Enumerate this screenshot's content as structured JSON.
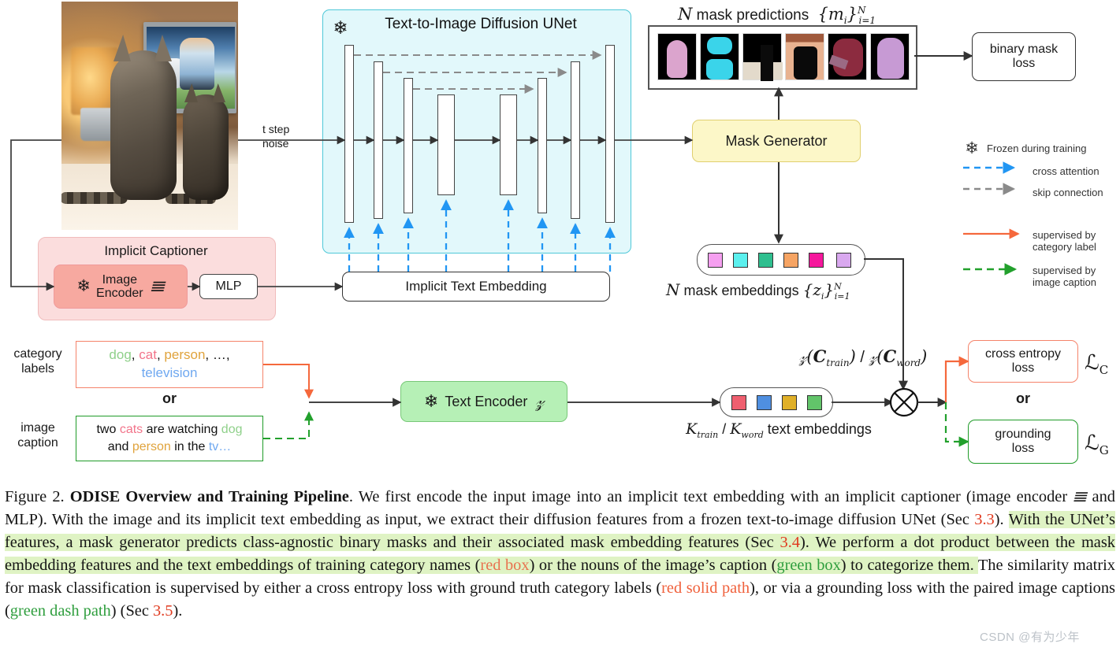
{
  "figure": {
    "title_prefix": "Figure 2.",
    "title_bold": "ODISE Overview and Training Pipeline",
    "watermark": "CSDN @有为少年"
  },
  "unet": {
    "title": "Text-to-Image Diffusion UNet",
    "frozen_icon": "snowflake-icon",
    "noise_label_line1": "t step",
    "noise_label_line2": "noise",
    "implicit_text_embedding": "Implicit Text Embedding",
    "block_heights": [
      226,
      200,
      172,
      128,
      128,
      172,
      200,
      226
    ],
    "block_x": [
      437,
      474,
      512,
      555,
      634,
      678,
      721,
      766
    ],
    "skip_count": 3
  },
  "captioner": {
    "title": "Implicit Captioner",
    "image_encoder_line1": "Image",
    "image_encoder_line2": "Encoder",
    "image_encoder_symbol": "ᵛ",
    "mlp": "MLP"
  },
  "mask_branch": {
    "mask_generator": "Mask Generator",
    "mask_predictions_label": "N mask predictions",
    "mask_predictions_math": "{m_i}_{i=1}^{N}",
    "binary_mask_loss_line1": "binary mask",
    "binary_mask_loss_line2": "loss",
    "mask_embeddings_label": "N mask embeddings",
    "mask_embeddings_math": "{z_i}_{i=1}^{N}",
    "mask_chip_colors": [
      "#f59ff0",
      "#5bf0ee",
      "#2fbf8f",
      "#f6a463",
      "#f5179c",
      "#d9a8ef"
    ],
    "thumb_colors": [
      "#d9a0c9",
      "#3ad2e8",
      "#e6ddd0",
      "#e8b08a",
      "#8e2b3f",
      "#c79ad4"
    ]
  },
  "text_branch": {
    "category_label_line1": "category",
    "category_label_line2": "labels",
    "caption_label_line1": "image",
    "caption_label_line2": "caption",
    "or_left": "or",
    "or_right": "or",
    "category_items": [
      {
        "text": "dog",
        "color": "#8fd08a"
      },
      {
        "text": ", ",
        "color": "#111111"
      },
      {
        "text": "cat",
        "color": "#f2748a"
      },
      {
        "text": ", ",
        "color": "#111111"
      },
      {
        "text": "person",
        "color": "#e0a33c"
      },
      {
        "text": ", …,",
        "color": "#111111"
      }
    ],
    "category_second_line": {
      "text": "television",
      "color": "#6fa8f0"
    },
    "caption_tokens": [
      {
        "text": "two ",
        "color": "#111111"
      },
      {
        "text": "cats ",
        "color": "#f2748a"
      },
      {
        "text": "are watching ",
        "color": "#111111"
      },
      {
        "text": "dog",
        "color": "#8fd08a"
      }
    ],
    "caption_tokens2": [
      {
        "text": "and ",
        "color": "#111111"
      },
      {
        "text": "person ",
        "color": "#e0a33c"
      },
      {
        "text": "in the ",
        "color": "#111111"
      },
      {
        "text": "tv…",
        "color": "#6fa8f0"
      }
    ],
    "text_encoder": "Text Encoder",
    "text_encoder_symbol": "𝒯",
    "text_embeddings_math": "𝒯(C_train) / 𝒯(C_word)",
    "text_embeddings_caption": "K_train / K_word text embeddings",
    "text_chip_colors": [
      "#ef5f6f",
      "#4f8fe0",
      "#e0b028",
      "#62c46a"
    ]
  },
  "losses": {
    "cross_entropy_line1": "cross entropy",
    "cross_entropy_line2": "loss",
    "cross_entropy_symbol": "ℒC",
    "grounding_line1": "grounding",
    "grounding_line2": "loss",
    "grounding_symbol": "ℒG"
  },
  "legend": {
    "frozen": "Frozen during training",
    "cross_attention": "cross attention",
    "skip_connection": "skip connection",
    "supervised_category_line1": "supervised by",
    "supervised_category_line2": "category label",
    "supervised_caption_line1": "supervised by",
    "supervised_caption_line2": "image caption",
    "colors": {
      "cross_attention": "#2196f3",
      "skip_connection": "#8a8a8a",
      "category": "#f5683c",
      "caption": "#22a02c"
    }
  },
  "caption_text": {
    "p1": " We first encode the input image into an implicit text embedding with an implicit captioner (image encoder ",
    "p1b": " and MLP). With the image and its implicit text embedding as input, we extract their diffusion features from a frozen text-to-image diffusion UNet (Sec ",
    "sec33": "3.3",
    "p2": "). ",
    "hl1": "With the UNet’s features, a mask generator predicts class-agnostic binary masks and their associated mask embedding features (Sec ",
    "sec34": "3.4",
    "hl1b": "). ",
    "hl2": "We perform a dot product between the mask embedding features and the text embeddings of training category names (",
    "redbox": "red box",
    "hl2b": ") or the nouns of the image’s caption (",
    "greenbox": "green box",
    "hl2c": ") to categorize them. ",
    "p3": "The similarity matrix for mask classification is supervised by either a cross entropy loss with ground truth category labels (",
    "redpath": "red solid path",
    "p4": "), or via a grounding loss with the paired image captions (",
    "greenpath": "green dash path",
    "p5": ") (Sec ",
    "sec35": "3.5",
    "p6": ")."
  }
}
